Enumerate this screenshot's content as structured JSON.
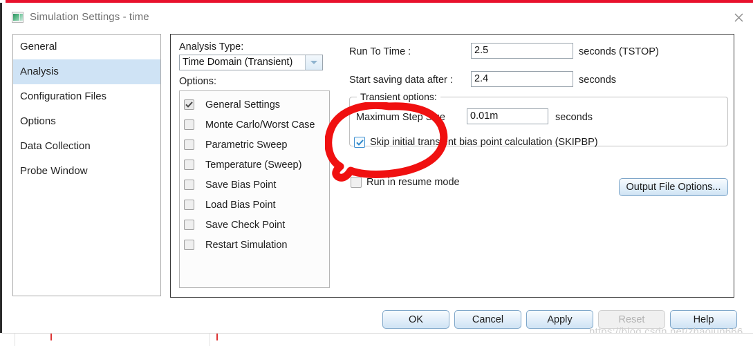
{
  "window": {
    "title": "Simulation Settings - time",
    "icon": "app-icon",
    "close_icon": "close-icon",
    "accent_red": "#e8112d"
  },
  "sidebar": {
    "items": [
      {
        "label": "General",
        "selected": false
      },
      {
        "label": "Analysis",
        "selected": true
      },
      {
        "label": "Configuration Files",
        "selected": false
      },
      {
        "label": "Options",
        "selected": false
      },
      {
        "label": "Data Collection",
        "selected": false
      },
      {
        "label": "Probe Window",
        "selected": false
      }
    ],
    "selected_color": "#cfe3f5"
  },
  "analysis": {
    "type_label": "Analysis Type:",
    "type_value": "Time Domain (Transient)",
    "options_label": "Options:",
    "options": [
      {
        "label": "General Settings",
        "checked": true
      },
      {
        "label": "Monte Carlo/Worst Case",
        "checked": false
      },
      {
        "label": "Parametric Sweep",
        "checked": false
      },
      {
        "label": "Temperature (Sweep)",
        "checked": false
      },
      {
        "label": "Save Bias Point",
        "checked": false
      },
      {
        "label": "Load Bias Point",
        "checked": false
      },
      {
        "label": "Save Check Point",
        "checked": false
      },
      {
        "label": "Restart Simulation",
        "checked": false
      }
    ]
  },
  "general_settings": {
    "run_to_time_label": "Run To Time :",
    "run_to_time_value": "2.5",
    "run_to_time_units": "seconds (TSTOP)",
    "start_saving_label": "Start saving data after :",
    "start_saving_value": "2.4",
    "start_saving_units": "seconds",
    "transient_group_title": "Transient options:",
    "max_step_label": "Maximum Step Size",
    "max_step_value": "0.01m",
    "max_step_units": "seconds",
    "skipbp_label": "Skip initial transient bias point calculation (SKIPBP)",
    "skipbp_checked": true,
    "resume_label": "Run in resume mode",
    "resume_checked": false,
    "output_file_options_label": "Output File Options..."
  },
  "footer": {
    "buttons": [
      {
        "label": "OK",
        "disabled": false
      },
      {
        "label": "Cancel",
        "disabled": false
      },
      {
        "label": "Apply",
        "disabled": false
      },
      {
        "label": "Reset",
        "disabled": true
      },
      {
        "label": "Help",
        "disabled": false
      }
    ]
  },
  "annotation": {
    "type": "red-circle-highlight",
    "color": "#f01010",
    "target": "Skip initial transient bias point calculation (SKIPBP)"
  },
  "watermark": {
    "text": "https://blog.csdn.net/zhaojun666"
  }
}
